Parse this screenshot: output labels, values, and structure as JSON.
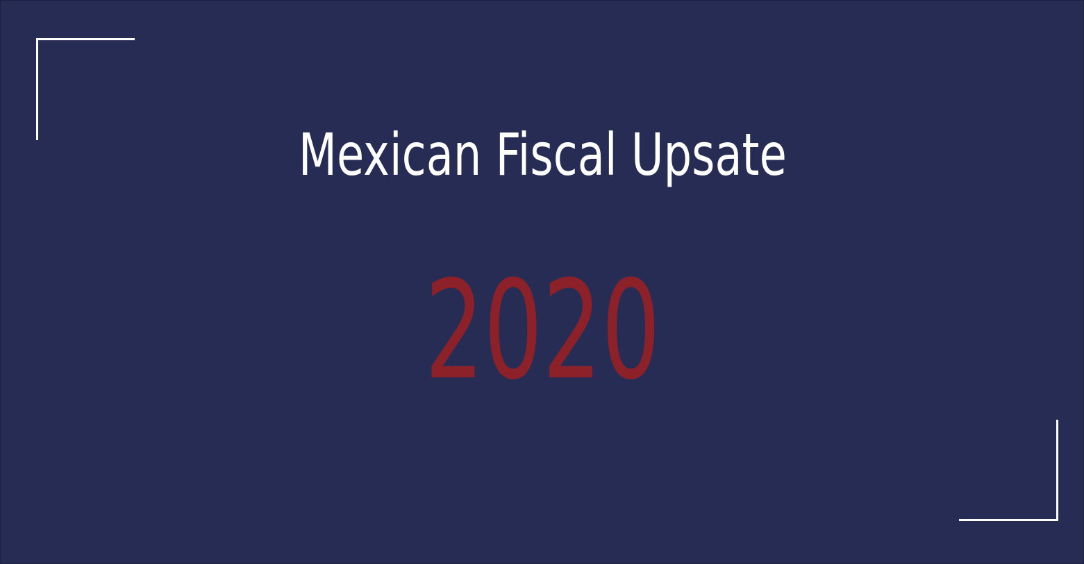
{
  "slide": {
    "title": "Mexican Fiscal Upsate",
    "year": "2020"
  },
  "colors": {
    "background": "#272c54",
    "title_text": "#ffffff",
    "year_text": "#8c2129",
    "corner_lines": "#ffffff"
  }
}
